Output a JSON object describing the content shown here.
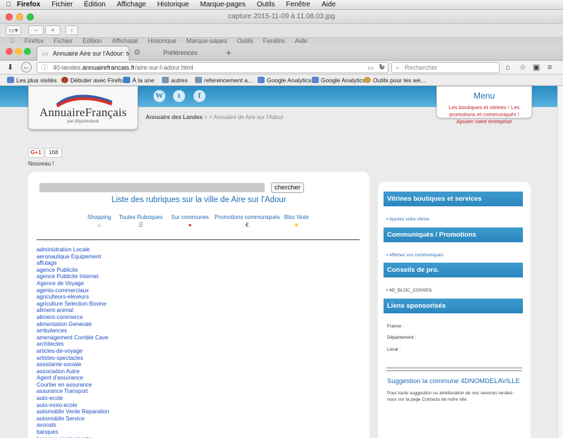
{
  "os_menubar": {
    "items": [
      "Firefox",
      "Fichier",
      "Édition",
      "Affichage",
      "Historique",
      "Marque-pages",
      "Outils",
      "Fenêtre",
      "Aide"
    ]
  },
  "preview": {
    "title": "capture 2015-11-09 à 11.08.03.jpg"
  },
  "ghost_menu": {
    "items": [
      "Firefox",
      "Fichier",
      "Édition",
      "Affichage",
      "Historique",
      "Marque-pages",
      "Outils",
      "Fenêtre",
      "Aide"
    ]
  },
  "browser": {
    "tabs": [
      {
        "label": "Annuaire Aire sur l'Adour: to..."
      },
      {
        "label": "Préférences"
      }
    ],
    "url_prefix": "40-landes.",
    "url_domain": "annuairefrancais.fr",
    "url_path": "/aire-sur-l-adour.html",
    "search_placeholder": "Rechercher",
    "bookmarks": [
      {
        "label": "Les plus visités",
        "color": "#5a7fc8"
      },
      {
        "label": "Débuter avec Firefox",
        "color": "#b43a2a"
      },
      {
        "label": "À la une",
        "color": "#3c7ed0"
      },
      {
        "label": "autres",
        "color": "#7b94b5"
      },
      {
        "label": "referencement a...",
        "color": "#7b94b5"
      },
      {
        "label": "Google Analytics",
        "color": "#5b86c7"
      },
      {
        "label": "Google Analytics",
        "color": "#5b86c7"
      },
      {
        "label": "Outils pour les we...",
        "color": "#c9a23a"
      }
    ]
  },
  "site": {
    "logo_text": "AnnuaireFrançais",
    "logo_sub": "par département",
    "social": [
      {
        "icon": "wordpress-icon",
        "glyph": "W"
      },
      {
        "icon": "twitter-icon",
        "glyph": "t"
      },
      {
        "icon": "facebook-icon",
        "glyph": "f"
      }
    ],
    "breadcrumb_link": "Annuaire des Landes",
    "breadcrumb_rest": "> > Annuaire de Aire sur l'Adour",
    "menu_title": "Menu",
    "menu_links": "Les boutiques et vitrines ! Les promotions et communiqués ! Ajouter votre entreprise",
    "gplus_label": "G+1",
    "gplus_count": "168",
    "nouveau": "Nouveau !"
  },
  "main": {
    "search_button": "chercher",
    "title": "Liste des rubriques sur la ville de Aire sur l'Adour",
    "rubriques": [
      {
        "label": "Shopping",
        "icon": "⌂"
      },
      {
        "label": "Toutes Rubriques",
        "icon": "☰"
      },
      {
        "label": "Sur communes",
        "icon": "●"
      },
      {
        "label": "Promotions communiqués",
        "icon": "€"
      },
      {
        "label": "Bloc Note",
        "icon": "■"
      }
    ],
    "categories": [
      "administration Locale",
      "aeronautique Equipement",
      "affutage",
      "agence Publicite",
      "agence Publicite Internet",
      "Agence de Voyage",
      "agents-commerciaux",
      "agriculteurs-eleveurs",
      "agriculture Selection Bovine",
      "aliment-animal",
      "aliment-commerce",
      "alimentation Generale",
      "ambulances",
      "amenagement Comble Cave",
      "architectes",
      "articles-de-voyage",
      "artistes-spectacles",
      "assistante-sociale",
      "association Autre",
      "Agent d'assurance",
      "Courtier en assurance",
      "assurance Transport",
      "auto-ecole",
      "auto-moto-ecole",
      "automobile Vente Reparation",
      "automobile Service",
      "avocats",
      "banques",
      "bureaux-equipements"
    ]
  },
  "sidebar": {
    "vitrines_title": "Vitrines boutiques et services",
    "vitrines_link": "Ajoutez votre vitrine",
    "communiques_title": "Communiqués / Promotions",
    "communiques_link": "Affichez vos communiqués",
    "conseils_title": "Conseils de pro.",
    "conseils_link": "4D_BLOC_CONSEIL",
    "liens_title": "Liens sponsorisés",
    "label_france": "France :",
    "label_departement": "Département :",
    "label_local": "Local :",
    "suggest_title": "Suggestion la commune 4DNOMDELAVILLE",
    "suggest_text": "Pour toute suggestion ou amélioration de nos services rendez-vous sur la page Contacts de notre site."
  },
  "colors": {
    "header_blue": "#2a8bc2",
    "link_blue": "#1d6cb5",
    "menu_red": "#c0202a"
  }
}
